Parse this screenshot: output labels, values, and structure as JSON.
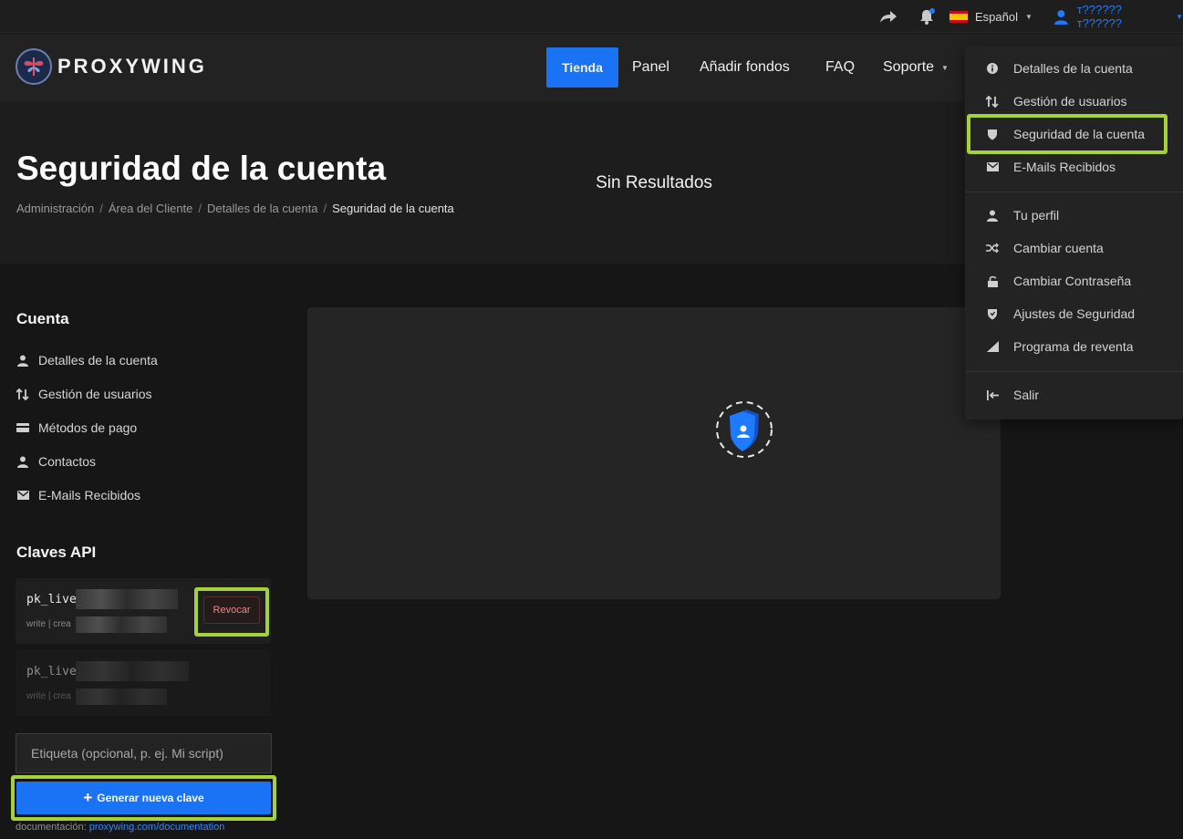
{
  "topbar": {
    "share_icon": "share-arrow-icon",
    "bell_icon": "bell-icon",
    "language": "Español",
    "user_name": "т?????? т??????"
  },
  "nav": {
    "brand": "PROXYWING",
    "items": [
      {
        "label": "Tienda",
        "active": true
      },
      {
        "label": "Panel"
      },
      {
        "label": "Añadir fondos"
      },
      {
        "label": "FAQ"
      },
      {
        "label": "Soporte"
      }
    ]
  },
  "page": {
    "title": "Seguridad de la cuenta",
    "breadcrumb": [
      "Administración",
      "Área del Cliente",
      "Detalles de la cuenta",
      "Seguridad de la cuenta"
    ],
    "separator": "/"
  },
  "sidebar": {
    "account_heading": "Cuenta",
    "items": [
      {
        "label": "Detalles de la cuenta",
        "icon": "user-icon"
      },
      {
        "label": "Gestión de usuarios",
        "icon": "arrows-updown-icon"
      },
      {
        "label": "Métodos de pago",
        "icon": "card-icon"
      },
      {
        "label": "Contactos",
        "icon": "user-icon"
      },
      {
        "label": "E-Mails Recibidos",
        "icon": "mail-icon"
      }
    ],
    "api_heading": "Claves API",
    "keys": [
      {
        "prefix": "pk_live_",
        "meta": "write | crea",
        "revoke_label": "Revocar"
      },
      {
        "prefix": "pk_live_",
        "meta": "write | crea"
      }
    ],
    "label_placeholder": "Etiqueta (opcional, p. ej. Mi script)",
    "generate_label": "Generar nueva clave",
    "doc_prefix": "documentación:",
    "doc_link": "proxywing.com/documentation"
  },
  "main": {
    "empty_icon": "shield-user-icon",
    "empty_text": "Sin Resultados"
  },
  "dropdown": {
    "group1": [
      {
        "label": "Detalles de la cuenta",
        "icon": "info-icon"
      },
      {
        "label": "Gestión de usuarios",
        "icon": "arrows-updown-icon"
      },
      {
        "label": "Seguridad de la cuenta",
        "icon": "shield-icon"
      },
      {
        "label": "E-Mails Recibidos",
        "icon": "mail-icon"
      }
    ],
    "group2": [
      {
        "label": "Tu perfil",
        "icon": "user-icon"
      },
      {
        "label": "Cambiar cuenta",
        "icon": "shuffle-icon"
      },
      {
        "label": "Cambiar Contraseña",
        "icon": "lock-icon"
      },
      {
        "label": "Ajustes de Seguridad",
        "icon": "shield-icon"
      },
      {
        "label": "Programa de reventa",
        "icon": "signal-icon"
      }
    ],
    "logout": {
      "label": "Salir",
      "icon": "logout-icon"
    }
  },
  "colors": {
    "accent": "#1a73f5",
    "highlight": "#a6d13a",
    "revoke": "#e78a8a"
  }
}
